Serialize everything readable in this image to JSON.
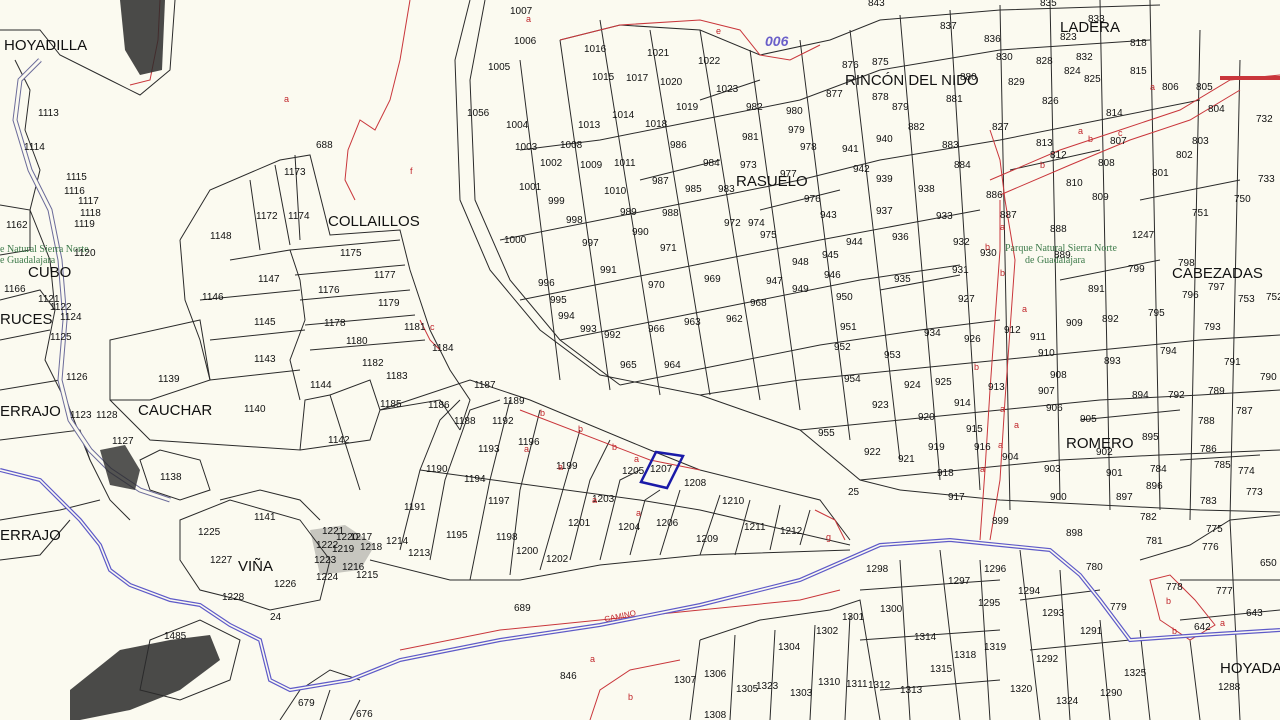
{
  "colors": {
    "background": "#fbfaf0",
    "parcel_line": "#2a2a2a",
    "road": "#5e5ac8",
    "red_line": "#c9363b",
    "highlight": "#1a1aa8",
    "park_text": "#3d7a4a",
    "route_text": "#6a5fc9"
  },
  "place_names": {
    "hoyadilla": "HOYADILLA",
    "collaillos": "COLLAILLOS",
    "cubo": "CUBO",
    "cruces": "RUCES",
    "cerrajo_1": "ERRAJO",
    "cauchar": "CAUCHAR",
    "cerrajo_2": "ERRAJO",
    "vina": "VIÑA",
    "ladera": "LADERA",
    "rincon": "RINCÓN DEL NIDO",
    "rasuelo": "RASUELO",
    "cabezadas": "CABEZADAS",
    "romero": "ROMERO",
    "hoyada": "HOYADA"
  },
  "route_label": "006",
  "road_label": "CAMINO",
  "park_labels": {
    "left_line1": "e Natural Sierra Norte",
    "left_line2": "e Guadalajara",
    "right_line1": "Parque Natural Sierra Norte",
    "right_line2": "de Guadalajara"
  },
  "highlighted_parcel": "1207",
  "parcels": [
    "1007",
    "1006",
    "1005",
    "1016",
    "1021",
    "1022",
    "1015",
    "1017",
    "1020",
    "1023",
    "1056",
    "1004",
    "1019",
    "1014",
    "1018",
    "1013",
    "1003",
    "1008",
    "1002",
    "1009",
    "1011",
    "986",
    "984",
    "982",
    "980",
    "981",
    "979",
    "978",
    "973",
    "1001",
    "1010",
    "987",
    "985",
    "983",
    "976",
    "941",
    "940",
    "999",
    "989",
    "988",
    "977",
    "974",
    "975",
    "943",
    "942",
    "939",
    "938",
    "998",
    "990",
    "972",
    "944",
    "937",
    "936",
    "933",
    "932",
    "930",
    "1000",
    "997",
    "971",
    "945",
    "991",
    "969",
    "948",
    "947",
    "970",
    "946",
    "968",
    "966",
    "935",
    "931",
    "996",
    "995",
    "994",
    "993",
    "992",
    "965",
    "964",
    "963",
    "962",
    "949",
    "950",
    "951",
    "952",
    "953",
    "954",
    "955",
    "934",
    "927",
    "926",
    "925",
    "924",
    "923",
    "922",
    "921",
    "920",
    "919",
    "918",
    "917",
    "914",
    "915",
    "916",
    "913",
    "912",
    "911",
    "910",
    "909",
    "908",
    "907",
    "906",
    "905",
    "904",
    "903",
    "902",
    "901",
    "900",
    "899",
    "898",
    "897",
    "896",
    "895",
    "894",
    "893",
    "892",
    "891",
    "889",
    "888",
    "887",
    "886",
    "884",
    "883",
    "882",
    "881",
    "880",
    "879",
    "878",
    "877",
    "876",
    "875",
    "843",
    "837",
    "836",
    "835",
    "833",
    "832",
    "830",
    "829",
    "828",
    "827",
    "826",
    "825",
    "824",
    "823",
    "818",
    "815",
    "814",
    "813",
    "812",
    "810",
    "809",
    "808",
    "807",
    "806",
    "805",
    "804",
    "803",
    "802",
    "801",
    "799",
    "798",
    "797",
    "796",
    "795",
    "794",
    "793",
    "792",
    "791",
    "790",
    "789",
    "788",
    "787",
    "786",
    "785",
    "784",
    "783",
    "782",
    "781",
    "780",
    "779",
    "778",
    "777",
    "776",
    "775",
    "774",
    "773",
    "752",
    "753",
    "751",
    "750",
    "732",
    "733",
    "1247",
    "1187",
    "1188",
    "1189",
    "1190",
    "1191",
    "1192",
    "1193",
    "1194",
    "1195",
    "1196",
    "1197",
    "1198",
    "1199",
    "1200",
    "1201",
    "1202",
    "1203",
    "1204",
    "1205",
    "1206",
    "1208",
    "1209",
    "1210",
    "1211",
    "1212",
    "1213",
    "1214",
    "1215",
    "1216",
    "1217",
    "1218",
    "1219",
    "1220",
    "1221",
    "1222",
    "1223",
    "1224",
    "1225",
    "1226",
    "1227",
    "1228",
    "1138",
    "1139",
    "1140",
    "1141",
    "1142",
    "1143",
    "1144",
    "1145",
    "1146",
    "1147",
    "1148",
    "1172",
    "1173",
    "1174",
    "1175",
    "1176",
    "1177",
    "1178",
    "1179",
    "1180",
    "1181",
    "1182",
    "1183",
    "1184",
    "1185",
    "1186",
    "1113",
    "1114",
    "1115",
    "1116",
    "1117",
    "1118",
    "1119",
    "1120",
    "1121",
    "1122",
    "1123",
    "1124",
    "1125",
    "1126",
    "1127",
    "1128",
    "1162",
    "1166",
    "1485",
    "688",
    "689",
    "846",
    "679",
    "676",
    "25",
    "24",
    "1298",
    "1297",
    "1296",
    "1295",
    "1294",
    "1293",
    "1292",
    "1291",
    "1290",
    "1288",
    "1300",
    "1301",
    "1302",
    "1303",
    "1304",
    "1305",
    "1306",
    "1307",
    "1308",
    "1310",
    "1311",
    "1312",
    "1313",
    "1314",
    "1315",
    "1318",
    "1319",
    "1320",
    "1323",
    "1324",
    "1325",
    "650",
    "643",
    "642"
  ],
  "subparcel_letters": [
    "a",
    "b",
    "c",
    "d",
    "e",
    "f",
    "g"
  ]
}
